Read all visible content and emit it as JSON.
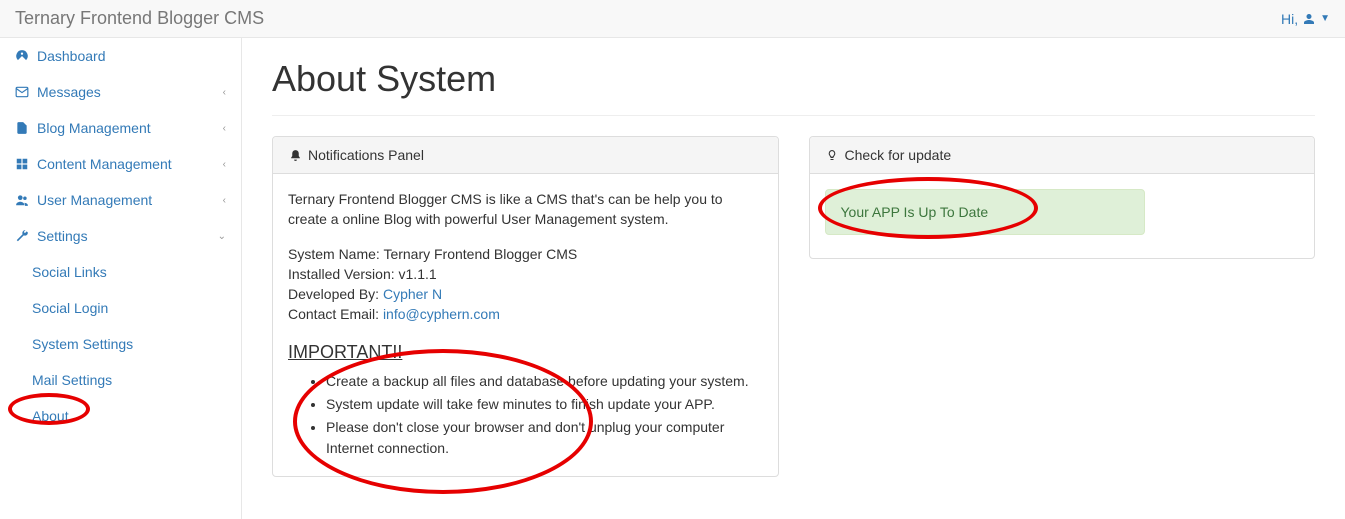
{
  "topbar": {
    "brand": "Ternary Frontend Blogger CMS",
    "hi": "Hi,"
  },
  "sidebar": {
    "items": [
      {
        "label": "Dashboard"
      },
      {
        "label": "Messages"
      },
      {
        "label": "Blog Management"
      },
      {
        "label": "Content Management"
      },
      {
        "label": "User Management"
      },
      {
        "label": "Settings"
      }
    ],
    "settings_children": [
      {
        "label": "Social Links"
      },
      {
        "label": "Social Login"
      },
      {
        "label": "System Settings"
      },
      {
        "label": "Mail Settings"
      },
      {
        "label": "About"
      }
    ]
  },
  "page": {
    "title": "About System"
  },
  "notifications": {
    "heading": "Notifications Panel",
    "intro": "Ternary Frontend Blogger CMS is like a CMS that's can be help you to create a online Blog with powerful User Management system.",
    "sys_name_label": "System Name: ",
    "sys_name_value": "Ternary Frontend Blogger CMS",
    "version_label": "Installed Version: ",
    "version_value": "v1.1.1",
    "dev_label": "Developed By: ",
    "dev_value": "Cypher N",
    "email_label": "Contact Email: ",
    "email_value": "info@cyphern.com",
    "important_heading": "IMPORTANT!!",
    "bullets": [
      "Create a backup all files and database before updating your system.",
      "System update will take few minutes to finish update your APP.",
      "Please don't close your browser and don't unplug your computer Internet connection."
    ]
  },
  "update": {
    "heading": "Check for update",
    "status": "Your APP Is Up To Date"
  }
}
